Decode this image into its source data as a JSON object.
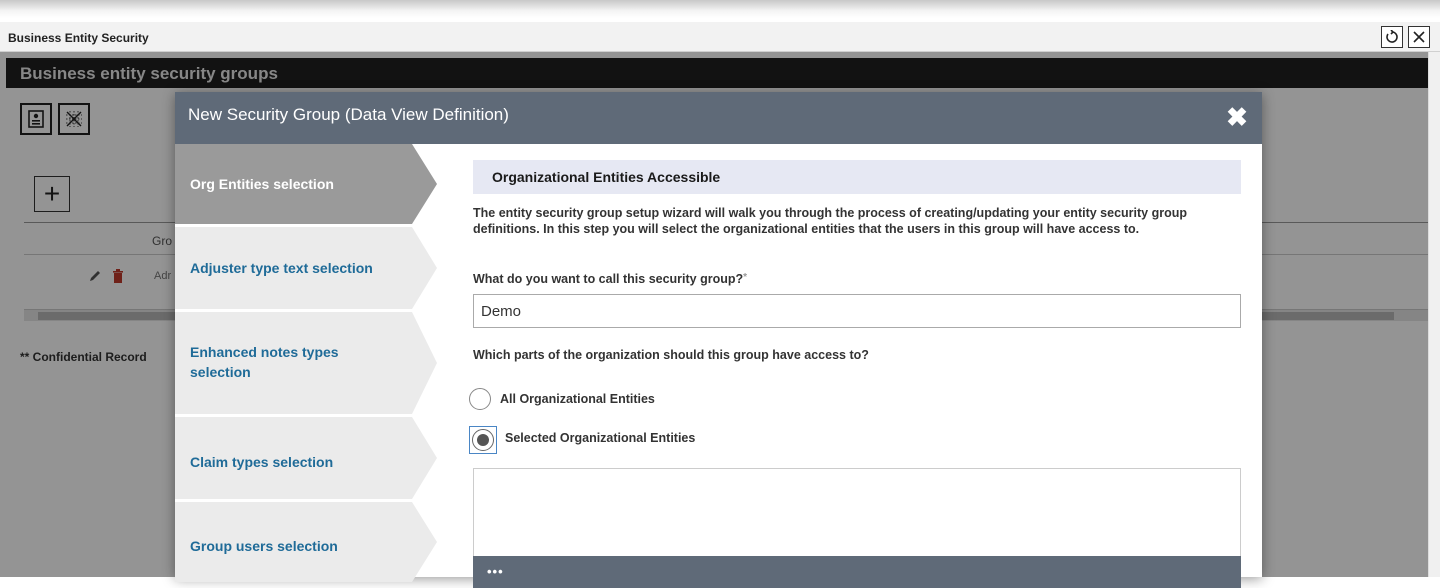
{
  "window": {
    "title": "Business Entity Security",
    "refresh_icon": "refresh-icon",
    "close_icon": "close-icon"
  },
  "page": {
    "heading": "Business entity security groups",
    "toolbar_icons": [
      "report-icon",
      "grid-clear-icon"
    ],
    "add_label": "+",
    "grid": {
      "header_partial": "Gro",
      "row_partial": "Adr",
      "row_icons": [
        "edit-icon",
        "delete-icon"
      ]
    },
    "confidential_note": "** Confidential Record"
  },
  "modal": {
    "title": "New Security Group (Data View Definition)",
    "close_label": "✖",
    "steps": [
      {
        "label": "Org Entities selection",
        "active": true
      },
      {
        "label": "Adjuster type text selection",
        "active": false
      },
      {
        "label": "Enhanced notes types selection",
        "active": false
      },
      {
        "label": "Claim types selection",
        "active": false
      },
      {
        "label": "Group users selection",
        "active": false
      }
    ],
    "section_title": "Organizational Entities Accessible",
    "description": "The entity security group setup wizard will walk you through the process of creating/updating your entity security group definitions. In this step you will select the organizational entities that the users in this group will have access to.",
    "name_question": "What do you want to call this security group?",
    "name_required": "*",
    "name_value": "Demo",
    "access_question": "Which parts of the organization should this group have access to?",
    "options": [
      {
        "label": "All Organizational Entities",
        "checked": false
      },
      {
        "label": "Selected Organizational Entities",
        "checked": true
      }
    ],
    "entities_footer": "•••"
  },
  "colors": {
    "modal_header": "#5f6a78",
    "step_active": "#9a9a9a",
    "step_inactive": "#ebebeb",
    "step_text": "#1f6b98",
    "section_bg": "#e6e8f3"
  }
}
